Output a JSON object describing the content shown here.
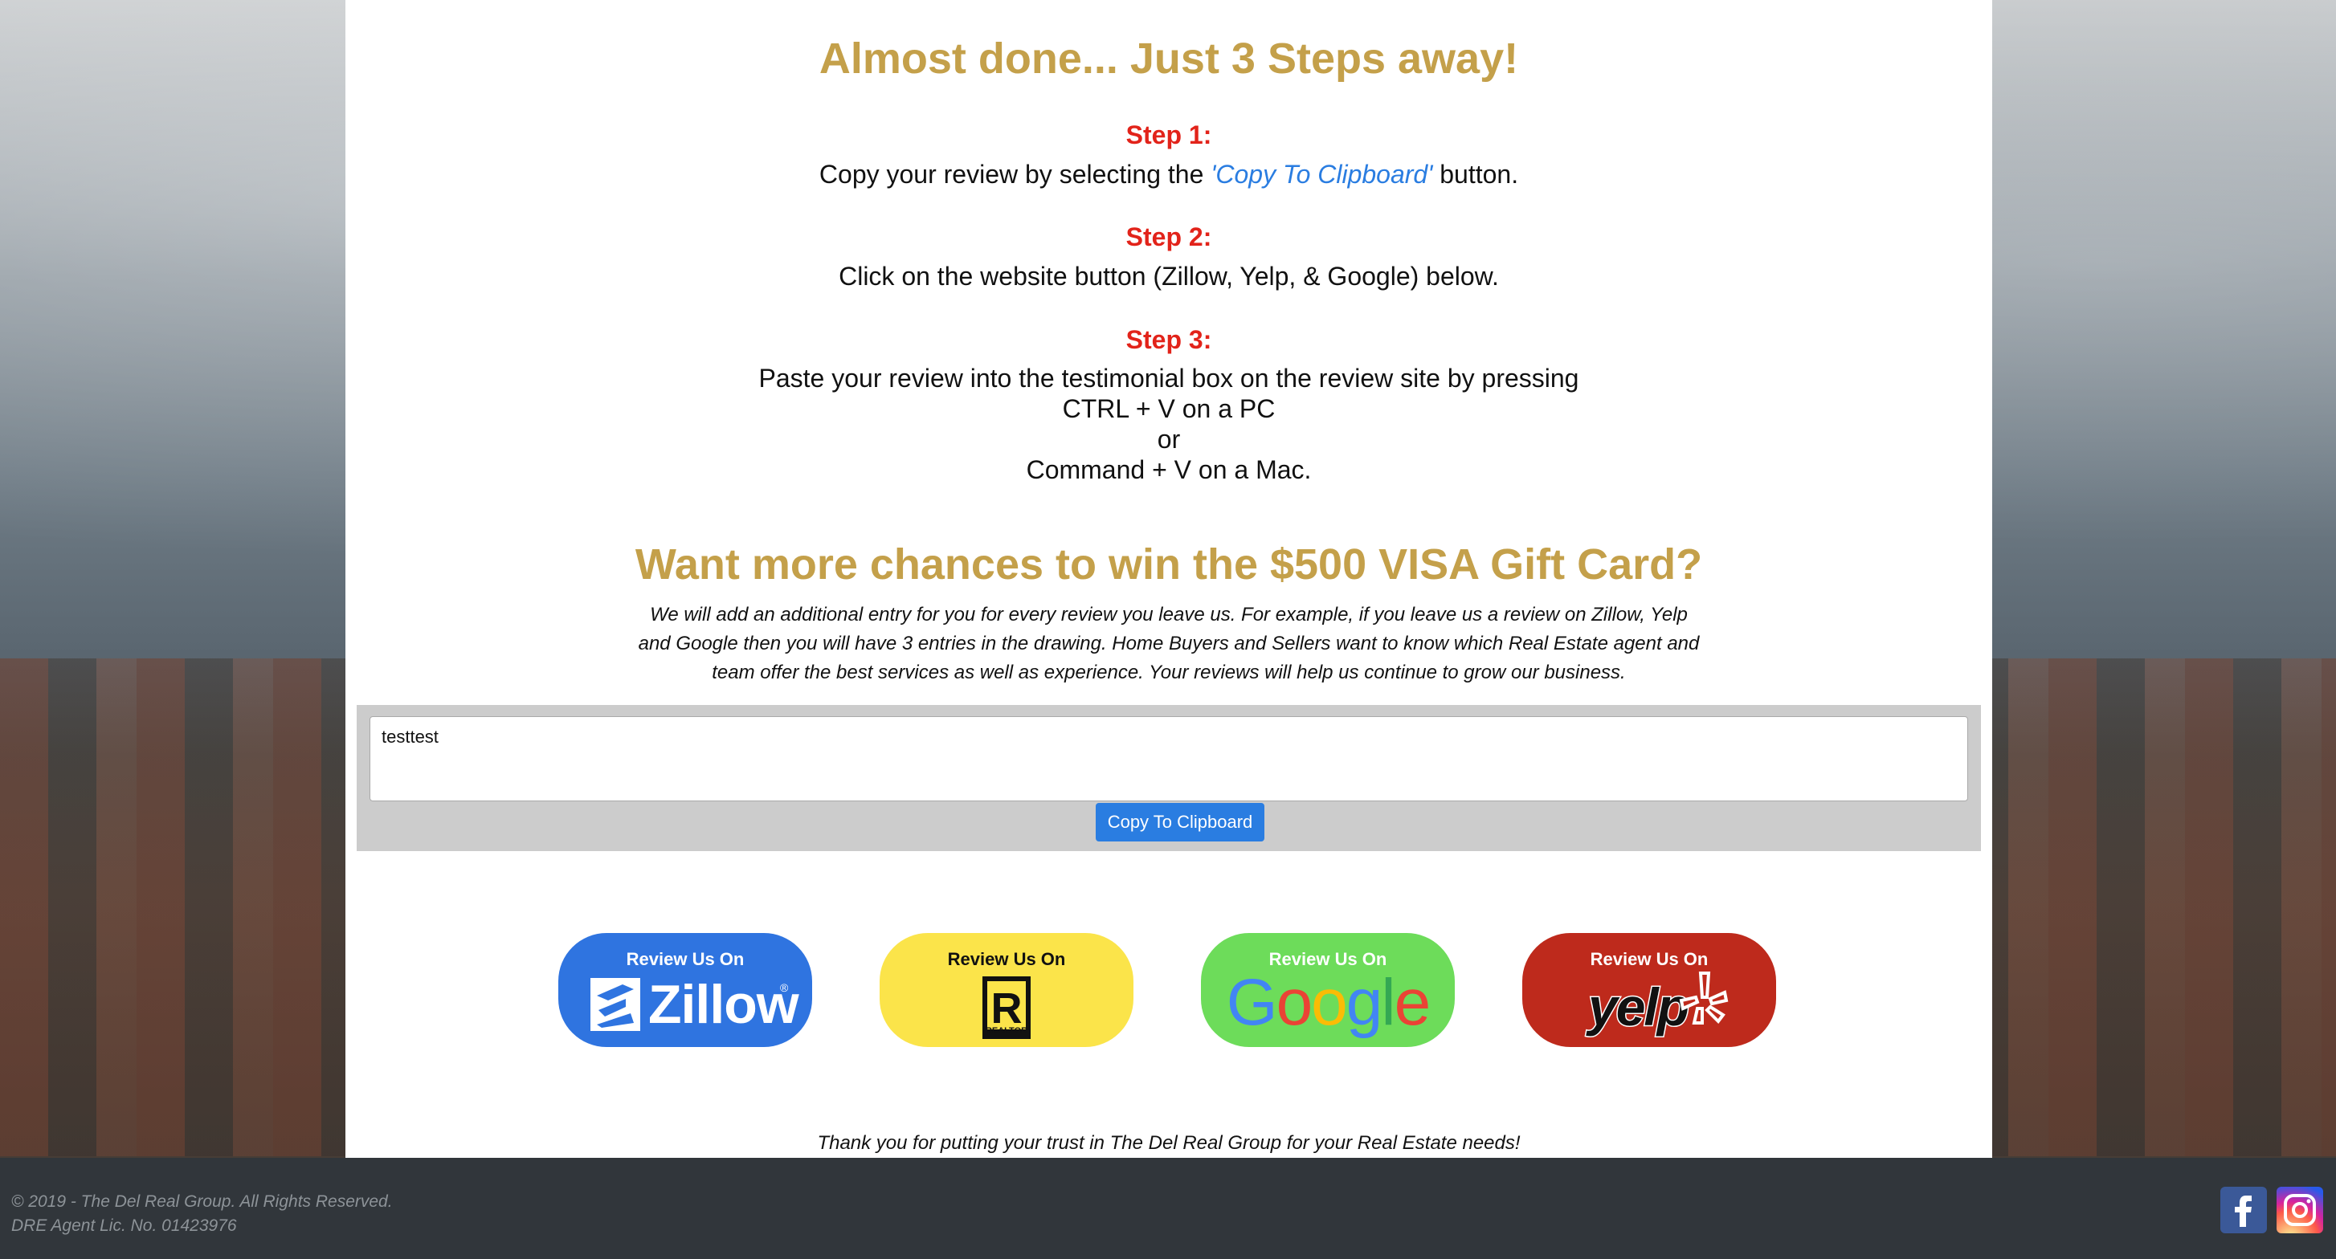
{
  "main": {
    "heading": "Almost done... Just 3 Steps away!",
    "steps": [
      {
        "title": "Step 1:",
        "text_before": "Copy your review by selecting the ",
        "text_link": "'Copy To Clipboard'",
        "text_after": " button."
      },
      {
        "title": "Step 2:",
        "text": "Click on the website button (Zillow, Yelp, & Google) below."
      },
      {
        "title": "Step 3:",
        "lines": [
          "Paste your review into the testimonial box on the review site by pressing",
          "CTRL + V on a PC",
          "or",
          "Command + V on a Mac."
        ]
      }
    ],
    "promo_heading": "Want more chances to win the $500 VISA Gift Card?",
    "promo_lines": [
      "We will add an additional entry for you for every review you leave us. For example, if you leave us a review on Zillow, Yelp",
      "and Google then you will have 3 entries in the drawing. Home Buyers and Sellers want to know which Real Estate agent and",
      "team offer the best services as well as experience. Your reviews will help us continue to grow our business."
    ],
    "review_value": "testtest",
    "copy_button_label": "Copy To Clipboard",
    "review_buttons": [
      {
        "caption": "Review Us On",
        "site": "Zillow",
        "reg": "®",
        "color": "#2f74e0"
      },
      {
        "caption": "Review Us On",
        "site": "R",
        "sub": "REALTOR",
        "color": "#fbe44a"
      },
      {
        "caption": "Review Us On",
        "site": "Google",
        "color": "#6ddc5a"
      },
      {
        "caption": "Review Us On",
        "site": "yelp",
        "color": "#be2a1c"
      }
    ],
    "thanks": "Thank you for putting your trust in The Del Real Group for your Real Estate needs!"
  },
  "footer": {
    "copyright": "© 2019 - The Del Real Group. All Rights Reserved.",
    "license": "DRE Agent Lic. No. 01423976",
    "social_icons": [
      "facebook-icon",
      "instagram-icon"
    ]
  },
  "colors": {
    "accent_gold": "#c4a04a",
    "step_red": "#e2231a",
    "link_blue": "#2a7de1",
    "footer_bg": "#31363b"
  }
}
